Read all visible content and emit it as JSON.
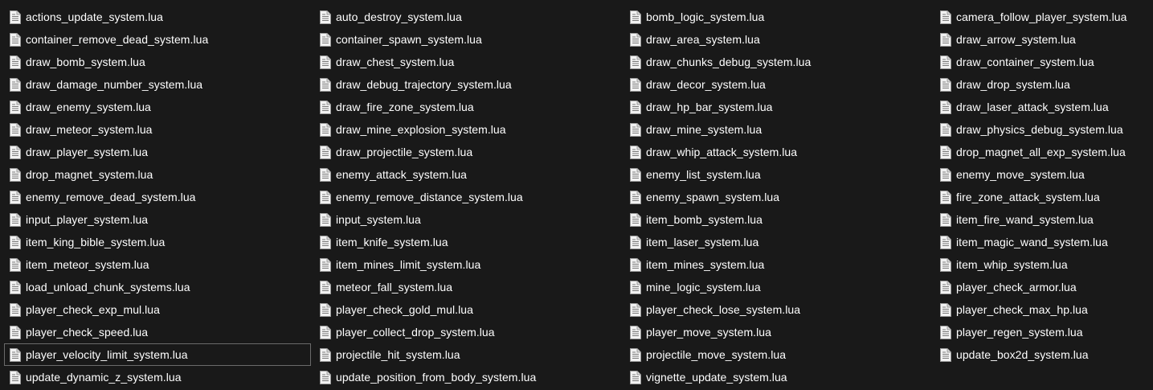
{
  "window": {
    "background_color": "#191919",
    "text_color": "#ffffff",
    "focus_border_color": "#6a6a6a"
  },
  "file_icon": "text-document-icon",
  "files": [
    {
      "name": "actions_update_system.lua"
    },
    {
      "name": "auto_destroy_system.lua"
    },
    {
      "name": "bomb_logic_system.lua"
    },
    {
      "name": "camera_follow_player_system.lua"
    },
    {
      "name": "container_remove_dead_system.lua"
    },
    {
      "name": "container_spawn_system.lua"
    },
    {
      "name": "draw_area_system.lua"
    },
    {
      "name": "draw_arrow_system.lua"
    },
    {
      "name": "draw_bomb_system.lua"
    },
    {
      "name": "draw_chest_system.lua"
    },
    {
      "name": "draw_chunks_debug_system.lua"
    },
    {
      "name": "draw_container_system.lua"
    },
    {
      "name": "draw_damage_number_system.lua"
    },
    {
      "name": "draw_debug_trajectory_system.lua"
    },
    {
      "name": "draw_decor_system.lua"
    },
    {
      "name": "draw_drop_system.lua"
    },
    {
      "name": "draw_enemy_system.lua"
    },
    {
      "name": "draw_fire_zone_system.lua"
    },
    {
      "name": "draw_hp_bar_system.lua"
    },
    {
      "name": "draw_laser_attack_system.lua"
    },
    {
      "name": "draw_meteor_system.lua"
    },
    {
      "name": "draw_mine_explosion_system.lua"
    },
    {
      "name": "draw_mine_system.lua"
    },
    {
      "name": "draw_physics_debug_system.lua"
    },
    {
      "name": "draw_player_system.lua"
    },
    {
      "name": "draw_projectile_system.lua"
    },
    {
      "name": "draw_whip_attack_system.lua"
    },
    {
      "name": "drop_magnet_all_exp_system.lua"
    },
    {
      "name": "drop_magnet_system.lua"
    },
    {
      "name": "enemy_attack_system.lua"
    },
    {
      "name": "enemy_list_system.lua"
    },
    {
      "name": "enemy_move_system.lua"
    },
    {
      "name": "enemy_remove_dead_system.lua"
    },
    {
      "name": "enemy_remove_distance_system.lua"
    },
    {
      "name": "enemy_spawn_system.lua"
    },
    {
      "name": "fire_zone_attack_system.lua"
    },
    {
      "name": "input_player_system.lua"
    },
    {
      "name": "input_system.lua"
    },
    {
      "name": "item_bomb_system.lua"
    },
    {
      "name": "item_fire_wand_system.lua"
    },
    {
      "name": "item_king_bible_system.lua"
    },
    {
      "name": "item_knife_system.lua"
    },
    {
      "name": "item_laser_system.lua"
    },
    {
      "name": "item_magic_wand_system.lua"
    },
    {
      "name": "item_meteor_system.lua"
    },
    {
      "name": "item_mines_limit_system.lua"
    },
    {
      "name": "item_mines_system.lua"
    },
    {
      "name": "item_whip_system.lua"
    },
    {
      "name": "load_unload_chunk_systems.lua"
    },
    {
      "name": "meteor_fall_system.lua"
    },
    {
      "name": "mine_logic_system.lua"
    },
    {
      "name": "player_check_armor.lua"
    },
    {
      "name": "player_check_exp_mul.lua"
    },
    {
      "name": "player_check_gold_mul.lua"
    },
    {
      "name": "player_check_lose_system.lua"
    },
    {
      "name": "player_check_max_hp.lua"
    },
    {
      "name": "player_check_speed.lua"
    },
    {
      "name": "player_collect_drop_system.lua"
    },
    {
      "name": "player_move_system.lua"
    },
    {
      "name": "player_regen_system.lua"
    },
    {
      "name": "player_velocity_limit_system.lua",
      "focused": true
    },
    {
      "name": "projectile_hit_system.lua"
    },
    {
      "name": "projectile_move_system.lua"
    },
    {
      "name": "update_box2d_system.lua"
    },
    {
      "name": "update_dynamic_z_system.lua"
    },
    {
      "name": "update_position_from_body_system.lua"
    },
    {
      "name": "vignette_update_system.lua"
    }
  ]
}
